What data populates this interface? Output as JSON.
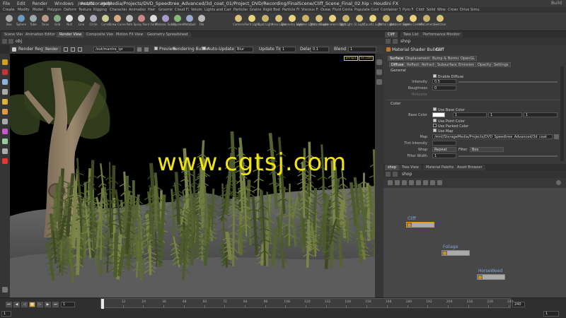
{
  "app": {
    "title": "/mnt/StorageMedia/Projects/DVD_Speedtree_Advanced/3d_coat_01/Project_DVD/Recording/FinalScene/Cliff_Scene_Final_02.hip - Houdini FX",
    "menus": [
      "File",
      "Edit",
      "Render",
      "Windows",
      "Assets",
      "Help"
    ],
    "desktop": "Build"
  },
  "shelf_tabs": [
    "Create",
    "Modify",
    "Model",
    "Polygon",
    "Deform",
    "Texture",
    "Rigging",
    "Character",
    "Animation",
    "Hair",
    "Grooming",
    "Cloud FX",
    "Volume",
    "Lights and Cameras",
    "Particles",
    "Grains",
    "Rigid Bodies",
    "Particle Fluids",
    "Viscous Fluids",
    "Oceans",
    "Fluid Containers",
    "Populate Containers",
    "Container Tools",
    "Pyro FX",
    "Cloth",
    "Solid",
    "Wires",
    "Crowds",
    "Drive Simulation"
  ],
  "shelf_tools_left": [
    "Box",
    "Sphere",
    "Tube",
    "Torus",
    "Grid",
    "Null",
    "Line",
    "Circle",
    "Curve",
    "Draw Curve",
    "Path",
    "Spray Paint",
    "Font",
    "Platonic Solids",
    "L-System",
    "Metaball",
    "File"
  ],
  "shelf_tools_right": [
    "Camera",
    "Point Light",
    "Spot Light",
    "Area Light",
    "Geometry Light",
    "Volume Light",
    "Distant Light",
    "Environment Light",
    "Sky Light",
    "GI Light",
    "Caustic Light",
    "Portal Light",
    "Ambient Light",
    "Stereo Camera",
    "VR Camera",
    "Switcher"
  ],
  "left_pane": {
    "tabs": [
      "Scene View",
      "Animation Editor",
      "Render View",
      "Composite View",
      "Motion FX View",
      "Geometry Spreadsheet"
    ],
    "path": "obj",
    "toolbar": {
      "render_region": "Render Region",
      "render_button": "Render",
      "renderer": "/out/mantra_ipr",
      "preview": "Preview",
      "rendering_buffer": "Rendering Buffer",
      "auto_update": "Auto-Update",
      "color_mode": "Blur",
      "update_time_label": "Update Time",
      "update_time": "1",
      "delay_label": "Delay",
      "delay": "0.1",
      "blend_label": "Blend",
      "blend": "1"
    },
    "overlay_tags": [
      "persp1",
      "no cam"
    ]
  },
  "right_pane": {
    "tabs": [
      "Cliff",
      "Take List",
      "Performance Monitor"
    ],
    "path": "shop",
    "header": "Material Shader Builder",
    "node_name": "Cliff",
    "main_tabs": [
      "Surface",
      "Displacement",
      "Bump & Normal",
      "OpenGL"
    ],
    "sub_tabs": [
      "Diffuse",
      "Reflect",
      "Refract",
      "Subsurface",
      "Emission",
      "Opacity",
      "Settings"
    ],
    "general_label": "General",
    "enable_diffuse": "Enable Diffuse",
    "intensity_label": "Intensity",
    "intensity": "0.5",
    "roughness_label": "Roughness",
    "roughness": "0",
    "rimcolor_label": "Rimcolor",
    "color_section": "Color",
    "use_base_color": "Use Base Color",
    "base_color_label": "Base Color",
    "base_color": [
      "1",
      "1",
      "1"
    ],
    "use_point_color": "Use Point Color",
    "use_packed_color": "Use Packed Color",
    "use_map": "Use Map",
    "map_label": "Map",
    "map": "/mnt/StorageMedia/Projects/DVD_Speedtree_Advanced/3d_coat",
    "tint_intensity_label": "Tint Intensity",
    "wrap_label": "Wrap",
    "wrap": "Repeat",
    "filter_label": "Filter",
    "filter": "Box",
    "filter_width_label": "Filter Width",
    "filter_width": "1"
  },
  "network_pane": {
    "tabs": [
      "shop",
      "Tree View",
      "Material Palette",
      "Asset Browser"
    ],
    "path": "shop",
    "nodes": [
      {
        "name": "Cliff"
      },
      {
        "name": "Foliage"
      },
      {
        "name": "HorseWeed"
      }
    ]
  },
  "timeline": {
    "start": "1",
    "end": "240",
    "current": "1",
    "ticks": [
      "1",
      "12",
      "24",
      "36",
      "48",
      "60",
      "72",
      "84",
      "96",
      "108",
      "120",
      "132",
      "144",
      "156",
      "168",
      "180",
      "192",
      "204",
      "216",
      "228",
      "240"
    ],
    "fps_field": "1",
    "end_field": "240"
  },
  "watermark": "www.cgtsj.com",
  "colors": {
    "watermark": "#f1e30f",
    "node_label": "#7fa6e6",
    "node_border": "#d9a100"
  }
}
